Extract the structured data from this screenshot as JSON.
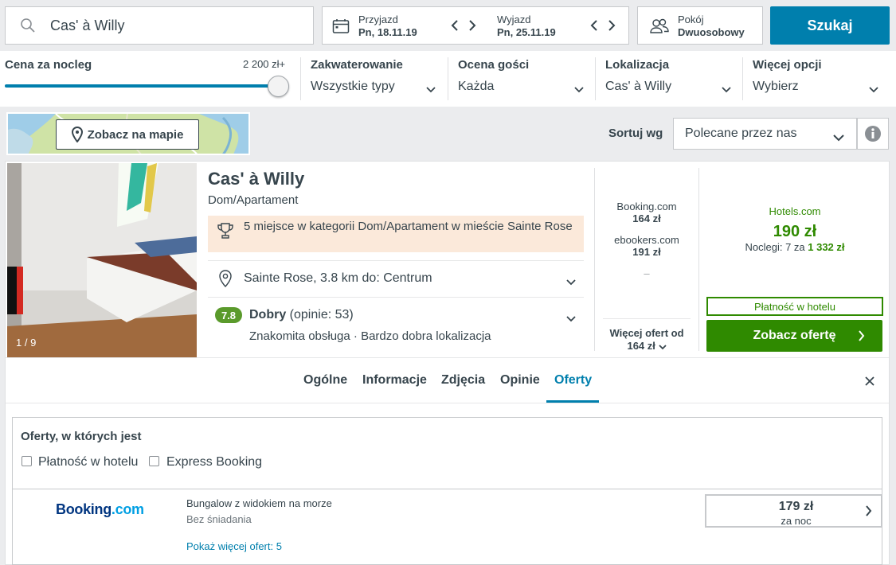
{
  "search": {
    "value": "Cas' à Willy"
  },
  "dates": {
    "checkin_label": "Przyjazd",
    "checkin_value": "Pn, 18.11.19",
    "checkout_label": "Wyjazd",
    "checkout_value": "Pn, 25.11.19"
  },
  "room": {
    "label": "Pokój",
    "value": "Dwuosobowy"
  },
  "search_button": "Szukaj",
  "filters": {
    "price_title": "Cena za nocleg",
    "price_max": "2 200 zł+",
    "accommodation_title": "Zakwaterowanie",
    "accommodation_value": "Wszystkie typy",
    "rating_title": "Ocena gości",
    "rating_value": "Każda",
    "location_title": "Lokalizacja",
    "location_value": "Cas' à Willy",
    "more_title": "Więcej opcji",
    "more_value": "Wybierz"
  },
  "map_button": "Zobacz na mapie",
  "sort": {
    "label": "Sortuj wg",
    "value": "Polecane przez nas"
  },
  "hotel": {
    "name": "Cas' à Willy",
    "type": "Dom/Apartament",
    "photo_count": "1 / 9",
    "award": "5 miejsce w kategorii Dom/Apartament w mieście Sainte Rose",
    "location": "Sainte Rose, 3.8 km do: Centrum",
    "rating_score": "7.8",
    "rating_word": "Dobry",
    "rating_reviews": " (opinie: 53)",
    "rating_highlights": "Znakomita obsługa · Bardzo dobra lokalizacja"
  },
  "partners": [
    {
      "name": "Booking.com",
      "price": "164 zł"
    },
    {
      "name": "ebookers.com",
      "price": "191 zł"
    },
    {
      "name": "–",
      "price": ""
    }
  ],
  "more_offers": {
    "line1": "Więcej ofert od",
    "line2": "164 zł"
  },
  "best_deal": {
    "partner": "Hotels.com",
    "price": "190 zł",
    "nights_prefix": "Noclegi: 7 za ",
    "nights_total": "1 332 zł",
    "payment_badge": "Płatność w hotelu",
    "cta": "Zobacz ofertę"
  },
  "tabs": [
    "Ogólne",
    "Informacje",
    "Zdjęcia",
    "Opinie",
    "Oferty"
  ],
  "offers_panel": {
    "title": "Oferty, w których jest",
    "checkbox_pay": "Płatność w hotelu",
    "checkbox_express": "Express Booking"
  },
  "offer": {
    "logo_main": "Booking",
    "logo_suffix": ".com",
    "room": "Bungalow z widokiem na morze",
    "meal": "Bez śniadania",
    "more_link": "Pokaż więcej ofert: 5",
    "price": "179 zł",
    "per": "za noc"
  },
  "colors": {
    "accent": "#007fad",
    "deal_green": "#2f8a00",
    "rating_green": "#5a9a2b",
    "award_bg": "#fbe9da"
  }
}
